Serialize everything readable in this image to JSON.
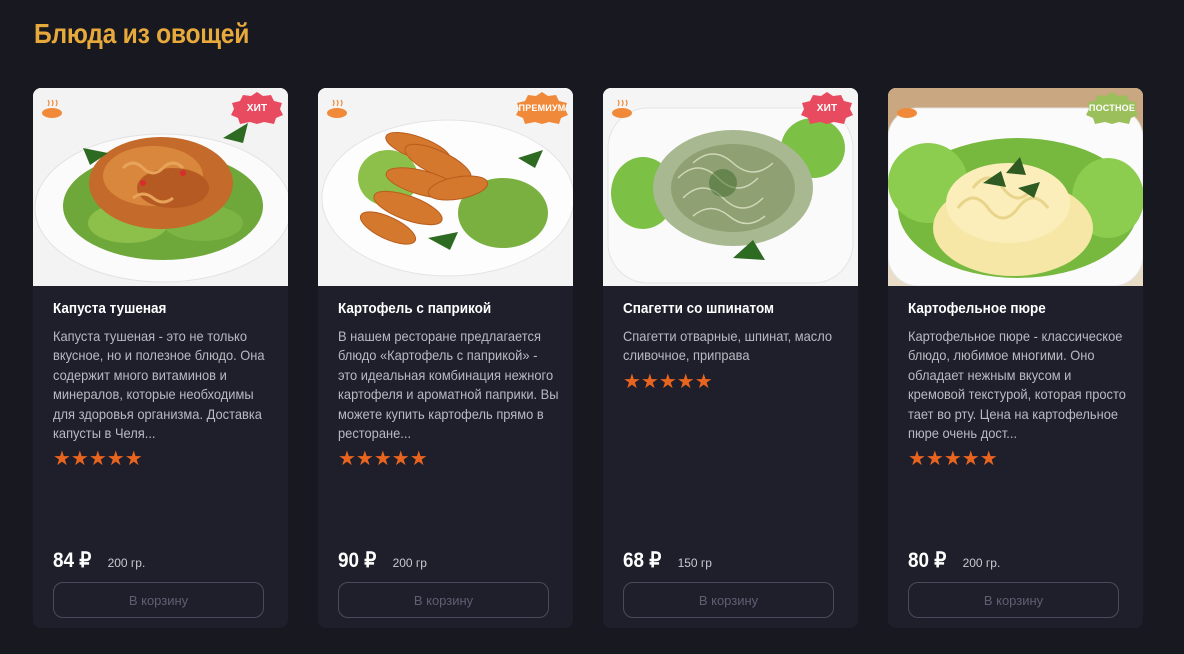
{
  "section": {
    "title": "Блюда из овощей"
  },
  "colors": {
    "accent": "#e8a93c",
    "star": "#e9641f",
    "hit": "#e84a5f",
    "premium": "#f08a3a",
    "lenten": "#9bbf5a"
  },
  "cards": [
    {
      "name": "Капуста тушеная",
      "description": "Капуста тушеная - это не только вкусное, но и полезное блюдо. Она содержит много витаминов и минералов, которые необходимы для здоровья организма. Доставка капусты в Челя...",
      "badge": "ХИТ",
      "rating": 5,
      "stars": "★★★★★",
      "price": "84 ₽",
      "weight": "200 гр.",
      "button": "В корзину"
    },
    {
      "name": "Картофель с паприкой",
      "description": "В нашем ресторане предлагается блюдо «Картофель с паприкой» - это идеальная комбинация нежного картофеля и ароматной паприки. Вы можете купить картофель прямо в ресторане...",
      "badge": "ПРЕМИУМ",
      "rating": 5,
      "stars": "★★★★★",
      "price": "90 ₽",
      "weight": "200 гр",
      "button": "В корзину"
    },
    {
      "name": "Спагетти со шпинатом",
      "description": "Спагетти отварные, шпинат, масло сливочное, приправа",
      "badge": "ХИТ",
      "rating": 5,
      "stars": "★★★★★",
      "price": "68 ₽",
      "weight": "150 гр",
      "button": "В корзину"
    },
    {
      "name": "Картофельное пюре",
      "description": "Картофельное пюре - классическое блюдо, любимое многими. Оно обладает нежным вкусом и кремовой текстурой, которая просто тает во рту. Цена на картофельное пюре очень дост...",
      "badge": "ПОСТНОЕ",
      "rating": 5,
      "stars": "★★★★★",
      "price": "80 ₽",
      "weight": "200 гр.",
      "button": "В корзину"
    }
  ]
}
